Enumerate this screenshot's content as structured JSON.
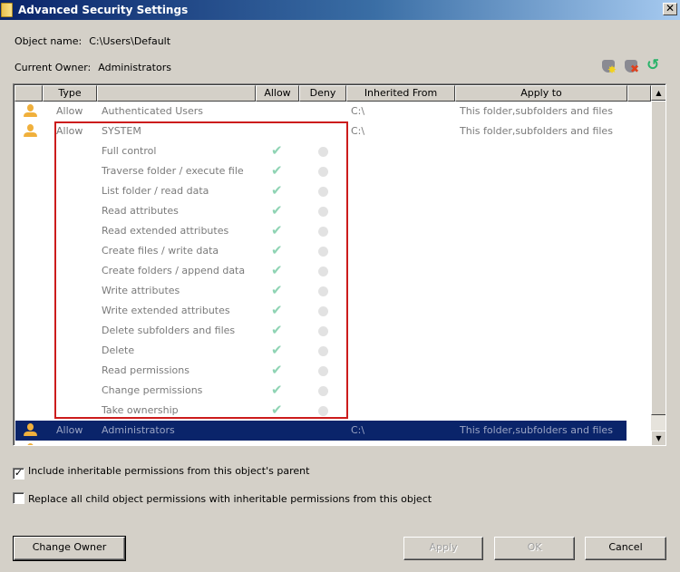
{
  "window": {
    "title": "Advanced Security Settings",
    "close_glyph": "✕"
  },
  "object_name": {
    "label": "Object name:",
    "value": "C:\\Users\\Default"
  },
  "current_owner": {
    "label": "Current Owner:",
    "value": "Administrators"
  },
  "toolbar": {
    "icons": [
      "add-permission-shield-icon",
      "remove-permission-shield-icon",
      "refresh-icon"
    ]
  },
  "table": {
    "columns": [
      "",
      "Type",
      "",
      "Allow",
      "Deny",
      "Inherited From",
      "Apply to"
    ],
    "rows": [
      {
        "type": "Allow",
        "principal": "Authenticated Users",
        "inherited_from": "C:\\",
        "apply_to": "This folder,subfolders and files",
        "selected": false
      },
      {
        "type": "Allow",
        "principal": "SYSTEM",
        "inherited_from": "C:\\",
        "apply_to": "This folder,subfolders and files",
        "selected": false
      },
      {
        "type": "Allow",
        "principal": "Administrators",
        "inherited_from": "C:\\",
        "apply_to": "This folder,subfolders and files",
        "selected": true
      }
    ],
    "system_permissions": [
      {
        "name": "Full control",
        "allow": true,
        "deny": false
      },
      {
        "name": "Traverse folder / execute file",
        "allow": true,
        "deny": false
      },
      {
        "name": "List folder / read data",
        "allow": true,
        "deny": false
      },
      {
        "name": "Read attributes",
        "allow": true,
        "deny": false
      },
      {
        "name": "Read extended attributes",
        "allow": true,
        "deny": false
      },
      {
        "name": "Create files / write data",
        "allow": true,
        "deny": false
      },
      {
        "name": "Create folders / append data",
        "allow": true,
        "deny": false
      },
      {
        "name": "Write attributes",
        "allow": true,
        "deny": false
      },
      {
        "name": "Write extended attributes",
        "allow": true,
        "deny": false
      },
      {
        "name": "Delete subfolders and files",
        "allow": true,
        "deny": false
      },
      {
        "name": "Delete",
        "allow": true,
        "deny": false
      },
      {
        "name": "Read permissions",
        "allow": true,
        "deny": false
      },
      {
        "name": "Change permissions",
        "allow": true,
        "deny": false
      },
      {
        "name": "Take ownership",
        "allow": true,
        "deny": false
      }
    ],
    "check_glyph": "✔",
    "highlight_color": "#cc1c1c",
    "selection_color": "#0a246a"
  },
  "scrollbar": {
    "up_glyph": "▲",
    "down_glyph": "▼"
  },
  "options": [
    {
      "label": "Include inheritable permissions from this object's parent",
      "checked": true,
      "glyph": "✓"
    },
    {
      "label": "Replace all child object permissions with inheritable permissions from this object",
      "checked": false,
      "glyph": ""
    }
  ],
  "buttons": {
    "change_owner": "Change Owner",
    "apply": "Apply",
    "ok": "OK",
    "cancel": "Cancel"
  }
}
